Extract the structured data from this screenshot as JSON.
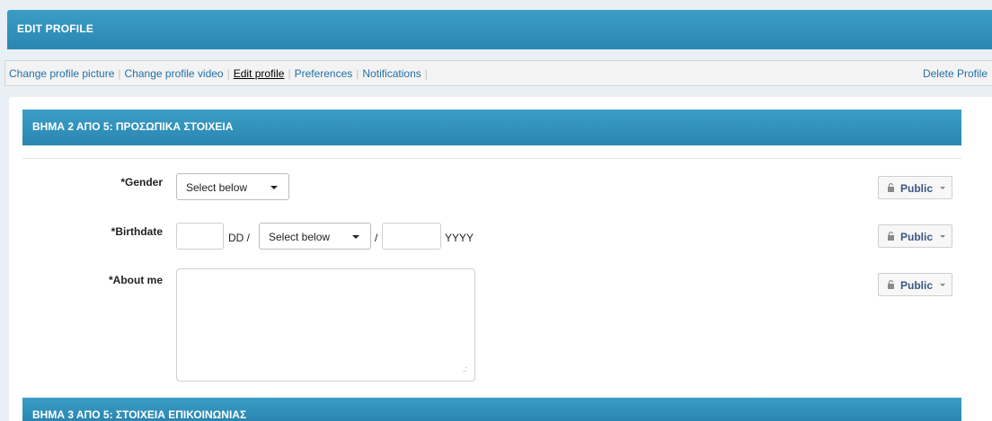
{
  "header": {
    "title": "EDIT PROFILE"
  },
  "subnav": {
    "links": [
      "Change profile picture",
      "Change profile video",
      "Edit profile",
      "Preferences",
      "Notifications"
    ],
    "active": "Edit profile",
    "delete_label": "Delete Profile"
  },
  "step2": {
    "title": "ΒΗΜΑ 2 ΑΠΟ 5: ΠΡΟΣΩΠΙΚΑ ΣΤΟΙΧΕΙΑ",
    "gender": {
      "label": "*Gender",
      "value": "Select below",
      "privacy": "Public"
    },
    "birthdate": {
      "label": "*Birthdate",
      "day_unit": "DD /",
      "month_value": "Select below",
      "separator": "/",
      "year_unit": "YYYY",
      "privacy": "Public"
    },
    "about": {
      "label": "*About me",
      "value": "",
      "privacy": "Public"
    }
  },
  "step3": {
    "title": "ΒΗΜΑ 3 ΑΠΟ 5: ΣΤΟΙΧΕΙΑ ΕΠΙΚΟΙΝΩΝΙΑΣ"
  },
  "icons": {
    "privacy": "lock-icon",
    "dropdown": "caret-down-icon",
    "resize": "resize-grip-icon"
  }
}
